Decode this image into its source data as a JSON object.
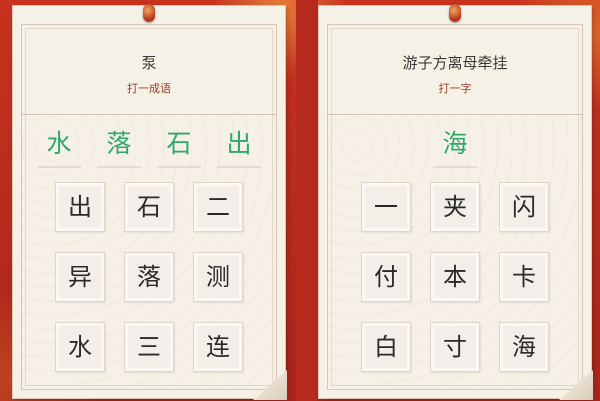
{
  "left_card": {
    "clue": "泵",
    "hint": "打一成语",
    "answer": [
      "水",
      "落",
      "石",
      "出"
    ],
    "tiles": [
      "出",
      "石",
      "二",
      "异",
      "落",
      "测",
      "水",
      "三",
      "连"
    ]
  },
  "right_card": {
    "clue": "游子方离母牵挂",
    "hint": "打一字",
    "answer": [
      "海"
    ],
    "tiles": [
      "一",
      "夹",
      "闪",
      "付",
      "本",
      "卡",
      "白",
      "寸",
      "海"
    ]
  },
  "colors": {
    "background": "#b52a1d",
    "card": "#f6f1e7",
    "answer_text": "#2fa86b",
    "hint_text": "#9b3b2a"
  }
}
